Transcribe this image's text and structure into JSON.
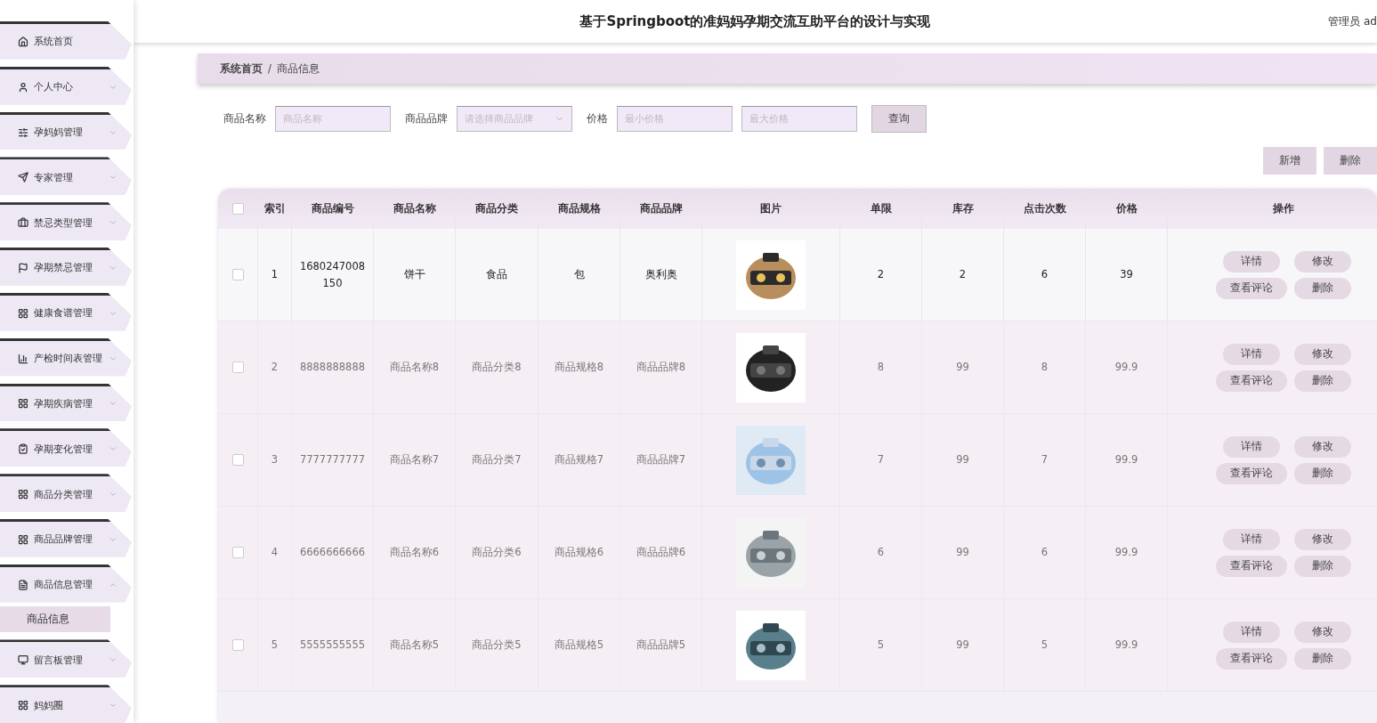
{
  "sidebar": {
    "items": [
      {
        "label": "系统首页",
        "kind": "link",
        "expanded": false
      },
      {
        "label": "个人中心",
        "kind": "menu",
        "expanded": false
      },
      {
        "label": "孕妈妈管理",
        "kind": "menu",
        "expanded": false
      },
      {
        "label": "专家管理",
        "kind": "menu",
        "expanded": false
      },
      {
        "label": "禁忌类型管理",
        "kind": "menu",
        "expanded": false
      },
      {
        "label": "孕期禁忌管理",
        "kind": "menu",
        "expanded": false
      },
      {
        "label": "健康食谱管理",
        "kind": "menu",
        "expanded": false
      },
      {
        "label": "产检时间表管理",
        "kind": "menu",
        "expanded": false
      },
      {
        "label": "孕期疾病管理",
        "kind": "menu",
        "expanded": false
      },
      {
        "label": "孕期变化管理",
        "kind": "menu",
        "expanded": false
      },
      {
        "label": "商品分类管理",
        "kind": "menu",
        "expanded": false
      },
      {
        "label": "商品品牌管理",
        "kind": "menu",
        "expanded": false
      },
      {
        "label": "商品信息管理",
        "kind": "menu",
        "expanded": true,
        "children": [
          {
            "label": "商品信息",
            "selected": true
          }
        ]
      },
      {
        "label": "留言板管理",
        "kind": "menu",
        "expanded": false
      },
      {
        "label": "妈妈圈",
        "kind": "menu",
        "expanded": false
      }
    ]
  },
  "header": {
    "title": "基于Springboot的准妈妈孕期交流互助平台的设计与实现",
    "user": "管理员 ad"
  },
  "breadcrumb": {
    "items": [
      "系统首页",
      "商品信息"
    ],
    "separator": "/"
  },
  "search": {
    "fields": [
      {
        "label": "商品名称",
        "kind": "input",
        "placeholder": "商品名称"
      },
      {
        "label": "商品品牌",
        "kind": "select",
        "placeholder": "请选择商品品牌"
      },
      {
        "label": "价格",
        "kind": "input",
        "placeholder": "最小价格"
      },
      {
        "kind": "input",
        "placeholder": "最大价格"
      }
    ],
    "button": "查询"
  },
  "actions": [
    "新增",
    "删除"
  ],
  "table": {
    "all_checked": false,
    "columns": [
      "索引",
      "商品编号",
      "商品名称",
      "商品分类",
      "商品规格",
      "商品品牌",
      "图片",
      "单限",
      "库存",
      "点击次数",
      "价格",
      "操作"
    ],
    "rows": [
      {
        "checked": false,
        "hovered": true,
        "cells": [
          "1",
          "1680247008150",
          "饼干",
          "食品",
          "包",
          "奥利奥"
        ],
        "picture": {
          "kind": "picture"
        },
        "stats": [
          "2",
          "2",
          "6",
          "39"
        ],
        "buttons": [
          "详情",
          "修改",
          "查看评论",
          "删除"
        ]
      },
      {
        "checked": false,
        "hovered": false,
        "cells": [
          "2",
          "8888888888",
          "商品名称8",
          "商品分类8",
          "商品规格8",
          "商品品牌8"
        ],
        "picture": {
          "kind": "picture"
        },
        "stats": [
          "8",
          "99",
          "8",
          "99.9"
        ],
        "buttons": [
          "详情",
          "修改",
          "查看评论",
          "删除"
        ]
      },
      {
        "checked": false,
        "hovered": false,
        "cells": [
          "3",
          "7777777777",
          "商品名称7",
          "商品分类7",
          "商品规格7",
          "商品品牌7"
        ],
        "picture": {
          "kind": "picture"
        },
        "stats": [
          "7",
          "99",
          "7",
          "99.9"
        ],
        "buttons": [
          "详情",
          "修改",
          "查看评论",
          "删除"
        ]
      },
      {
        "checked": false,
        "hovered": false,
        "cells": [
          "4",
          "6666666666",
          "商品名称6",
          "商品分类6",
          "商品规格6",
          "商品品牌6"
        ],
        "picture": {
          "kind": "picture"
        },
        "stats": [
          "6",
          "99",
          "6",
          "99.9"
        ],
        "buttons": [
          "详情",
          "修改",
          "查看评论",
          "删除"
        ]
      },
      {
        "checked": false,
        "hovered": false,
        "cells": [
          "5",
          "5555555555",
          "商品名称5",
          "商品分类5",
          "商品规格5",
          "商品品牌5"
        ],
        "picture": {
          "kind": "picture"
        },
        "stats": [
          "5",
          "99",
          "5",
          "99.9"
        ],
        "buttons": [
          "详情",
          "修改",
          "查看评论",
          "删除"
        ]
      }
    ]
  }
}
